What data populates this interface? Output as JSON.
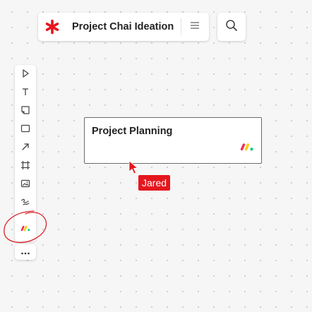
{
  "header": {
    "title": "Project Chai Ideation",
    "logo_icon": "asterisk-logo-icon",
    "menu_icon": "hamburger-menu-icon",
    "search_icon": "search-icon"
  },
  "toolbar": {
    "tools": [
      {
        "name": "select",
        "icon": "pointer-arrow-icon"
      },
      {
        "name": "text",
        "icon": "text-icon"
      },
      {
        "name": "sticky-note",
        "icon": "sticky-note-icon"
      },
      {
        "name": "shape",
        "icon": "rectangle-icon"
      },
      {
        "name": "connector",
        "icon": "arrow-icon"
      },
      {
        "name": "frame",
        "icon": "frame-icon"
      },
      {
        "name": "image",
        "icon": "image-icon"
      },
      {
        "name": "pen",
        "icon": "pen-icon"
      },
      {
        "name": "monday-app",
        "icon": "monday-logo-icon"
      }
    ],
    "more_icon": "more-dots-icon"
  },
  "canvas": {
    "card": {
      "title": "Project Planning",
      "logo_icon": "monday-logo-icon"
    },
    "collaborator": {
      "name": "Jared"
    }
  },
  "colors": {
    "accent_red": "#e5161e",
    "monday_red": "#f62b54",
    "monday_yellow": "#ffcb00",
    "monday_green": "#00ca72",
    "annotation_red": "#d9242a"
  }
}
